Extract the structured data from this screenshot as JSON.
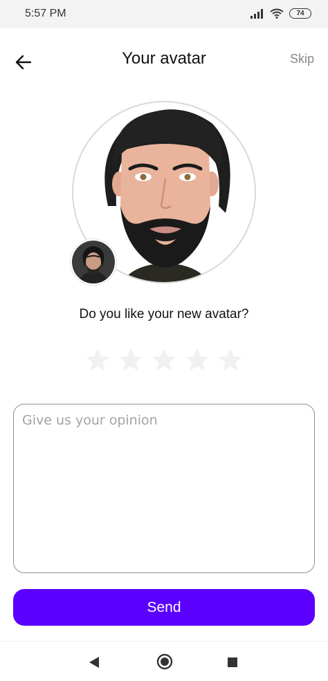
{
  "status_bar": {
    "time": "5:57 PM",
    "battery": "74"
  },
  "header": {
    "title": "Your avatar",
    "skip_label": "Skip"
  },
  "rating": {
    "question": "Do you like your new avatar?",
    "max": 5,
    "value": 0
  },
  "feedback": {
    "placeholder": "Give us your opinion",
    "value": ""
  },
  "send_label": "Send",
  "colors": {
    "accent": "#5b00ff",
    "star_inactive": "#f1f1f1"
  },
  "icons": {
    "back": "arrow-left-icon",
    "nav_back": "triangle-back-icon",
    "nav_home": "circle-home-icon",
    "nav_recents": "square-recents-icon"
  }
}
